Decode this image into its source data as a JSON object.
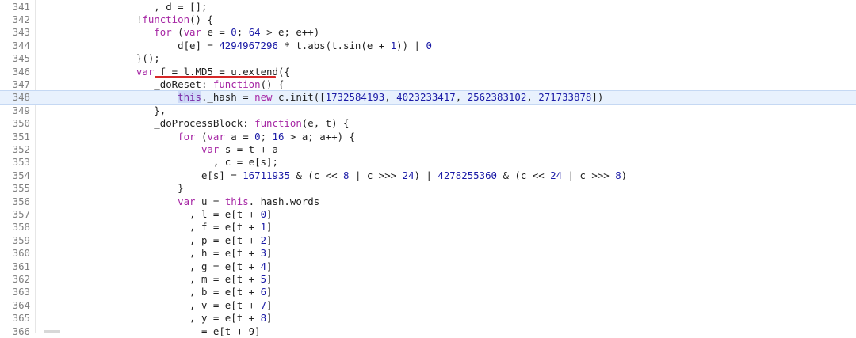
{
  "editor": {
    "lines": [
      {
        "num": "341",
        "indent": "                  ",
        "tokens": [
          {
            "t": ", d = [];"
          }
        ]
      },
      {
        "num": "342",
        "indent": "               ",
        "tokens": [
          {
            "t": "!"
          },
          {
            "t": "function",
            "c": "kw"
          },
          {
            "t": "() {"
          }
        ]
      },
      {
        "num": "343",
        "indent": "                  ",
        "tokens": [
          {
            "t": "for",
            "c": "kw"
          },
          {
            "t": " ("
          },
          {
            "t": "var",
            "c": "kw"
          },
          {
            "t": " e = "
          },
          {
            "t": "0",
            "c": "num"
          },
          {
            "t": "; "
          },
          {
            "t": "64",
            "c": "num"
          },
          {
            "t": " > e; e++)"
          }
        ]
      },
      {
        "num": "344",
        "indent": "                      ",
        "tokens": [
          {
            "t": "d[e] = "
          },
          {
            "t": "4294967296",
            "c": "num"
          },
          {
            "t": " * t.abs(t.sin(e + "
          },
          {
            "t": "1",
            "c": "num"
          },
          {
            "t": ")) | "
          },
          {
            "t": "0",
            "c": "num"
          }
        ]
      },
      {
        "num": "345",
        "indent": "               ",
        "tokens": [
          {
            "t": "}();"
          }
        ]
      },
      {
        "num": "346",
        "indent": "               ",
        "tokens": [
          {
            "t": "var",
            "c": "kw"
          },
          {
            "t": " f = l.MD5 = u.extend({"
          }
        ]
      },
      {
        "num": "347",
        "indent": "                  ",
        "tokens": [
          {
            "t": "_doReset: "
          },
          {
            "t": "function",
            "c": "kw"
          },
          {
            "t": "() {"
          }
        ]
      },
      {
        "num": "348",
        "indent": "                      ",
        "active": true,
        "tokens": [
          {
            "t": "this",
            "c": "this"
          },
          {
            "t": "._hash = "
          },
          {
            "t": "new",
            "c": "kw"
          },
          {
            "t": " c.init(["
          },
          {
            "t": "1732584193",
            "c": "num"
          },
          {
            "t": ", "
          },
          {
            "t": "4023233417",
            "c": "num"
          },
          {
            "t": ", "
          },
          {
            "t": "2562383102",
            "c": "num"
          },
          {
            "t": ", "
          },
          {
            "t": "271733878",
            "c": "num"
          },
          {
            "t": "])"
          }
        ]
      },
      {
        "num": "349",
        "indent": "                  ",
        "tokens": [
          {
            "t": "},"
          }
        ]
      },
      {
        "num": "350",
        "indent": "                  ",
        "tokens": [
          {
            "t": "_doProcessBlock: "
          },
          {
            "t": "function",
            "c": "kw"
          },
          {
            "t": "(e, t) {"
          }
        ]
      },
      {
        "num": "351",
        "indent": "                      ",
        "tokens": [
          {
            "t": "for",
            "c": "kw"
          },
          {
            "t": " ("
          },
          {
            "t": "var",
            "c": "kw"
          },
          {
            "t": " a = "
          },
          {
            "t": "0",
            "c": "num"
          },
          {
            "t": "; "
          },
          {
            "t": "16",
            "c": "num"
          },
          {
            "t": " > a; a++) {"
          }
        ]
      },
      {
        "num": "352",
        "indent": "                          ",
        "tokens": [
          {
            "t": "var",
            "c": "kw"
          },
          {
            "t": " s = t + a"
          }
        ]
      },
      {
        "num": "353",
        "indent": "                            ",
        "tokens": [
          {
            "t": ", c = e[s];"
          }
        ]
      },
      {
        "num": "354",
        "indent": "                          ",
        "tokens": [
          {
            "t": "e[s] = "
          },
          {
            "t": "16711935",
            "c": "num"
          },
          {
            "t": " & (c << "
          },
          {
            "t": "8",
            "c": "num"
          },
          {
            "t": " | c >>> "
          },
          {
            "t": "24",
            "c": "num"
          },
          {
            "t": ") | "
          },
          {
            "t": "4278255360",
            "c": "num"
          },
          {
            "t": " & (c << "
          },
          {
            "t": "24",
            "c": "num"
          },
          {
            "t": " | c >>> "
          },
          {
            "t": "8",
            "c": "num"
          },
          {
            "t": ")"
          }
        ]
      },
      {
        "num": "355",
        "indent": "                      ",
        "tokens": [
          {
            "t": "}"
          }
        ]
      },
      {
        "num": "356",
        "indent": "                      ",
        "tokens": [
          {
            "t": "var",
            "c": "kw"
          },
          {
            "t": " u = "
          },
          {
            "t": "this",
            "c": "kw"
          },
          {
            "t": "._hash.words"
          }
        ]
      },
      {
        "num": "357",
        "indent": "                        ",
        "tokens": [
          {
            "t": ", l = e[t + "
          },
          {
            "t": "0",
            "c": "num"
          },
          {
            "t": "]"
          }
        ]
      },
      {
        "num": "358",
        "indent": "                        ",
        "tokens": [
          {
            "t": ", f = e[t + "
          },
          {
            "t": "1",
            "c": "num"
          },
          {
            "t": "]"
          }
        ]
      },
      {
        "num": "359",
        "indent": "                        ",
        "tokens": [
          {
            "t": ", p = e[t + "
          },
          {
            "t": "2",
            "c": "num"
          },
          {
            "t": "]"
          }
        ]
      },
      {
        "num": "360",
        "indent": "                        ",
        "tokens": [
          {
            "t": ", h = e[t + "
          },
          {
            "t": "3",
            "c": "num"
          },
          {
            "t": "]"
          }
        ]
      },
      {
        "num": "361",
        "indent": "                        ",
        "tokens": [
          {
            "t": ", g = e[t + "
          },
          {
            "t": "4",
            "c": "num"
          },
          {
            "t": "]"
          }
        ]
      },
      {
        "num": "362",
        "indent": "                        ",
        "tokens": [
          {
            "t": ", m = e[t + "
          },
          {
            "t": "5",
            "c": "num"
          },
          {
            "t": "]"
          }
        ]
      },
      {
        "num": "363",
        "indent": "                        ",
        "tokens": [
          {
            "t": ", b = e[t + "
          },
          {
            "t": "6",
            "c": "num"
          },
          {
            "t": "]"
          }
        ]
      },
      {
        "num": "364",
        "indent": "                        ",
        "tokens": [
          {
            "t": ", v = e[t + "
          },
          {
            "t": "7",
            "c": "num"
          },
          {
            "t": "]"
          }
        ]
      },
      {
        "num": "365",
        "indent": "                        ",
        "tokens": [
          {
            "t": ", y = e[t + "
          },
          {
            "t": "8",
            "c": "num"
          },
          {
            "t": "]"
          }
        ]
      },
      {
        "num": "366",
        "indent": "                          ",
        "tokens": [
          {
            "t": "= e[t + 9]"
          }
        ]
      }
    ],
    "colors": {
      "keyword": "#a626a4",
      "number": "#1a1aa6",
      "active_line": "#e8f1fd",
      "annotation_underline": "#d62828"
    }
  }
}
